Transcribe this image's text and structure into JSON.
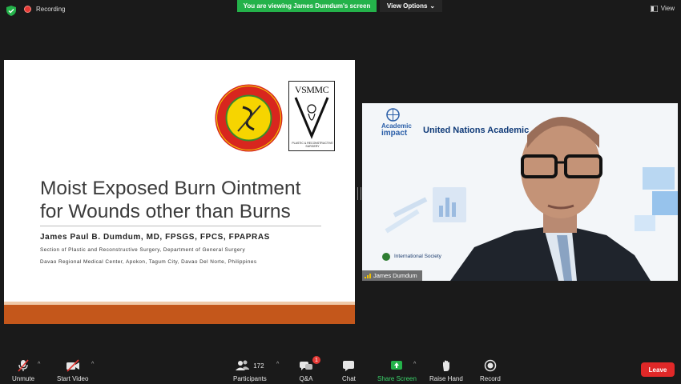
{
  "top_bar": {
    "recording_label": "Recording",
    "viewing_banner": "You are viewing James Dumdum's screen",
    "view_options_label": "View Options",
    "view_label": "View"
  },
  "slide": {
    "logo_department_text": "DEPARTMENT OF SURGERY",
    "logo_center_text": "DAVAO REGIONAL MEDICAL CENTER",
    "logo_vsmmc_text": "VSMMC",
    "logo_vsmmc_subtitle": "PLASTIC & RECONSTRUCTIVE SURGERY",
    "title_line1": "Moist Exposed Burn Ointment",
    "title_line2": "for Wounds other than Burns",
    "author": "James Paul B. Dumdum, MD, FPSGS, FPCS, FPAPRAS",
    "affiliation_line1": "Section of Plastic and Reconstructive Surgery, Department of General Surgery",
    "affiliation_line2": "Davao Regional Medical Center, Apokon, Tagum City, Davao Del Norte, Philippines",
    "accent_color": "#c4571b"
  },
  "video": {
    "participant_name": "James Dumdum",
    "bg_academic_label_line1": "Academic",
    "bg_academic_label_line2": "impact",
    "bg_title": "United Nations Academic",
    "bg_footer": "International Society"
  },
  "toolbar": {
    "unmute_label": "Unmute",
    "start_video_label": "Start Video",
    "participants_label": "Participants",
    "participants_count": "172",
    "qa_label": "Q&A",
    "qa_badge": "1",
    "chat_label": "Chat",
    "share_screen_label": "Share Screen",
    "raise_hand_label": "Raise Hand",
    "record_label": "Record",
    "leave_label": "Leave",
    "share_color": "#24b24a",
    "leave_color": "#e02828"
  }
}
